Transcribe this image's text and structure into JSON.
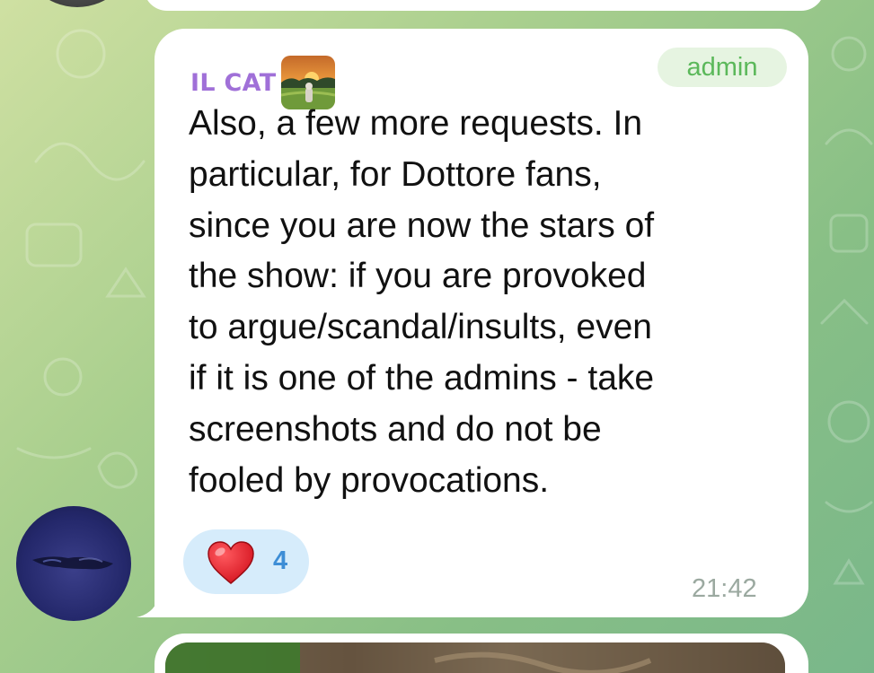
{
  "message": {
    "sender_name": "IL CAT",
    "badge": "admin",
    "text": "Also, a few more requests. In\nparticular, for Dottore fans,\nsince you are now the stars of\nthe show: if you are provoked\nto argue/scandal/insults, even\nif it is one of the admins - take\nscreenshots and do not be\nfooled by provocations.",
    "time": "21:42",
    "reaction": {
      "emoji_icon": "red-heart-icon",
      "count": "4"
    }
  },
  "colors": {
    "sender_name": "#a070d8",
    "badge_text": "#5bb85a",
    "badge_bg": "#e6f4e1",
    "reaction_bg": "#d6ecfb",
    "reaction_count": "#3e8ed6",
    "timestamp": "#9ba9a0",
    "heart": "#e8202c"
  }
}
